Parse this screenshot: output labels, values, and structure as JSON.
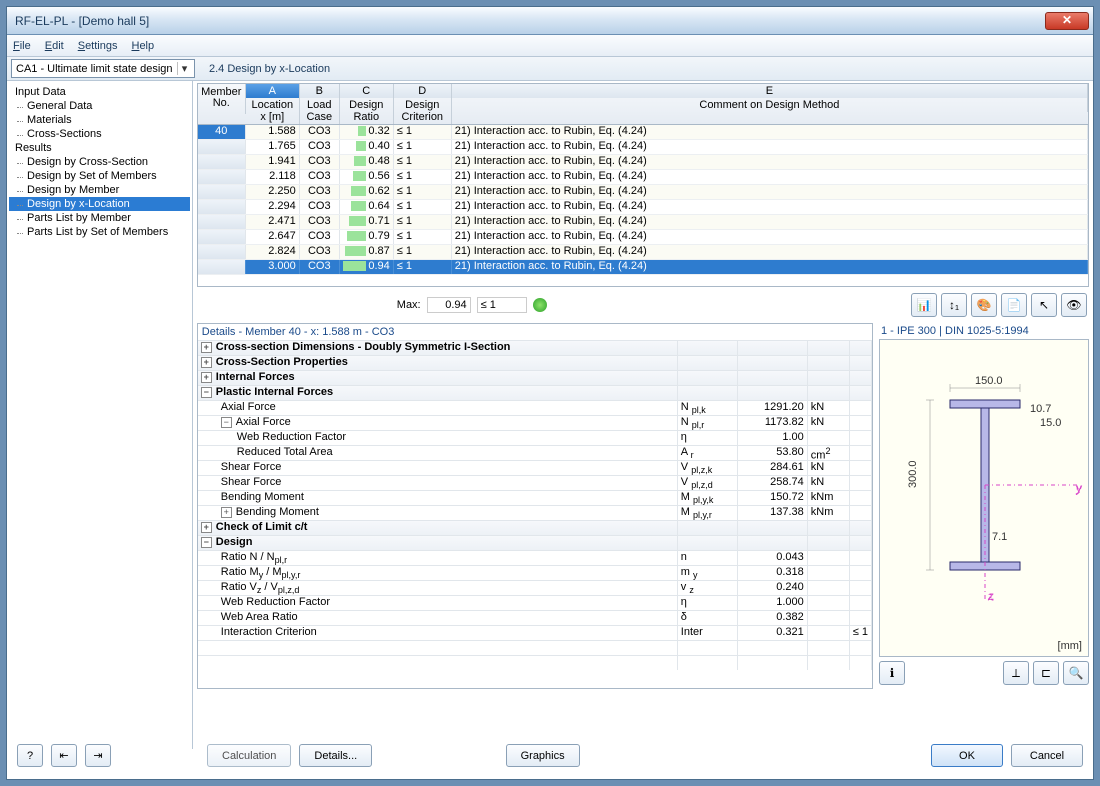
{
  "window": {
    "title": "RF-EL-PL - [Demo hall 5]"
  },
  "menu": [
    "File",
    "Edit",
    "Settings",
    "Help"
  ],
  "combo": "CA1 - Ultimate limit state design",
  "mainTitle": "2.4 Design by x-Location",
  "sidebar": {
    "inputData": "Input Data",
    "generalData": "General Data",
    "materials": "Materials",
    "crossSections": "Cross-Sections",
    "results": "Results",
    "r1": "Design by Cross-Section",
    "r2": "Design by Set of Members",
    "r3": "Design by Member",
    "r4": "Design by x-Location",
    "r5": "Parts List by Member",
    "r6": "Parts List by Set of Members"
  },
  "tableHead": {
    "memberNo": "Member No.",
    "A": "A",
    "B": "B",
    "C": "C",
    "D": "D",
    "E": "E",
    "location": "Location x [m]",
    "loadCase": "Load Case",
    "designRatio": "Design Ratio",
    "designCriterion": "Design Criterion",
    "comment": "Comment on Design Method"
  },
  "rows": [
    {
      "m": "40",
      "x": "1.588",
      "lc": "CO3",
      "r": "0.32",
      "c": "≤ 1",
      "cm": "21) Interaction acc. to Rubin, Eq. (4.24)"
    },
    {
      "m": "",
      "x": "1.765",
      "lc": "CO3",
      "r": "0.40",
      "c": "≤ 1",
      "cm": "21) Interaction acc. to Rubin, Eq. (4.24)"
    },
    {
      "m": "",
      "x": "1.941",
      "lc": "CO3",
      "r": "0.48",
      "c": "≤ 1",
      "cm": "21) Interaction acc. to Rubin, Eq. (4.24)"
    },
    {
      "m": "",
      "x": "2.118",
      "lc": "CO3",
      "r": "0.56",
      "c": "≤ 1",
      "cm": "21) Interaction acc. to Rubin, Eq. (4.24)"
    },
    {
      "m": "",
      "x": "2.250",
      "lc": "CO3",
      "r": "0.62",
      "c": "≤ 1",
      "cm": "21) Interaction acc. to Rubin, Eq. (4.24)"
    },
    {
      "m": "",
      "x": "2.294",
      "lc": "CO3",
      "r": "0.64",
      "c": "≤ 1",
      "cm": "21) Interaction acc. to Rubin, Eq. (4.24)"
    },
    {
      "m": "",
      "x": "2.471",
      "lc": "CO3",
      "r": "0.71",
      "c": "≤ 1",
      "cm": "21) Interaction acc. to Rubin, Eq. (4.24)"
    },
    {
      "m": "",
      "x": "2.647",
      "lc": "CO3",
      "r": "0.79",
      "c": "≤ 1",
      "cm": "21) Interaction acc. to Rubin, Eq. (4.24)"
    },
    {
      "m": "",
      "x": "2.824",
      "lc": "CO3",
      "r": "0.87",
      "c": "≤ 1",
      "cm": "21) Interaction acc. to Rubin, Eq. (4.24)"
    },
    {
      "m": "",
      "x": "3.000",
      "lc": "CO3",
      "r": "0.94",
      "c": "≤ 1",
      "cm": "21) Interaction acc. to Rubin, Eq. (4.24)",
      "sel": true
    }
  ],
  "maxLabel": "Max:",
  "maxRatio": "0.94",
  "maxCrit": "≤ 1",
  "detailsTitle": "Details - Member 40 - x: 1.588 m - CO3",
  "details": {
    "h1": "Cross-section Dimensions - Doubly Symmetric I-Section",
    "h2": "Cross-Section Properties",
    "h3": "Internal Forces",
    "h4": "Plastic Internal Forces",
    "axial": "Axial Force",
    "axialSym": "N pl,k",
    "axialVal": "1291.20",
    "axialUnit": "kN",
    "axial2": "Axial Force",
    "axial2Sym": "N pl,r",
    "axial2Val": "1173.82",
    "axial2Unit": "kN",
    "web": "Web Reduction Factor",
    "webSym": "η",
    "webVal": "1.00",
    "webUnit": "",
    "area": "Reduced Total Area",
    "areaSym": "A r",
    "areaVal": "53.80",
    "areaUnit": "cm²",
    "shear1": "Shear Force",
    "shear1Sym": "V pl,z,k",
    "shear1Val": "284.61",
    "shear1Unit": "kN",
    "shear2": "Shear Force",
    "shear2Sym": "V pl,z,d",
    "shear2Val": "258.74",
    "shear2Unit": "kN",
    "bend1": "Bending Moment",
    "bend1Sym": "M pl,y,k",
    "bend1Val": "150.72",
    "bend1Unit": "kNm",
    "bend2": "Bending Moment",
    "bend2Sym": "M pl,y,r",
    "bend2Val": "137.38",
    "bend2Unit": "kNm",
    "h5": "Check of Limit c/t",
    "h6": "Design",
    "rn": "Ratio N / N pl,r",
    "rnSym": "n",
    "rnVal": "0.043",
    "rm": "Ratio M y / M pl,y,r",
    "rmSym": "m y",
    "rmVal": "0.318",
    "rv": "Ratio V z / V pl,z,d",
    "rvSym": "v z",
    "rvVal": "0.240",
    "wr": "Web Reduction Factor",
    "wrSym": "η",
    "wrVal": "1.000",
    "wa": "Web Area Ratio",
    "waSym": "δ",
    "waVal": "0.382",
    "ic": "Interaction Criterion",
    "icSym": "Inter",
    "icVal": "0.321",
    "icCrit": "≤ 1"
  },
  "crossTitle": "1 - IPE 300 | DIN 1025-5:1994",
  "crossUnit": "[mm]",
  "dims": {
    "w": "150.0",
    "h": "300.0",
    "tf": "10.7",
    "tw": "7.1",
    "tfr": "15.0"
  },
  "buttons": {
    "calc": "Calculation",
    "details": "Details...",
    "graphics": "Graphics",
    "ok": "OK",
    "cancel": "Cancel"
  }
}
